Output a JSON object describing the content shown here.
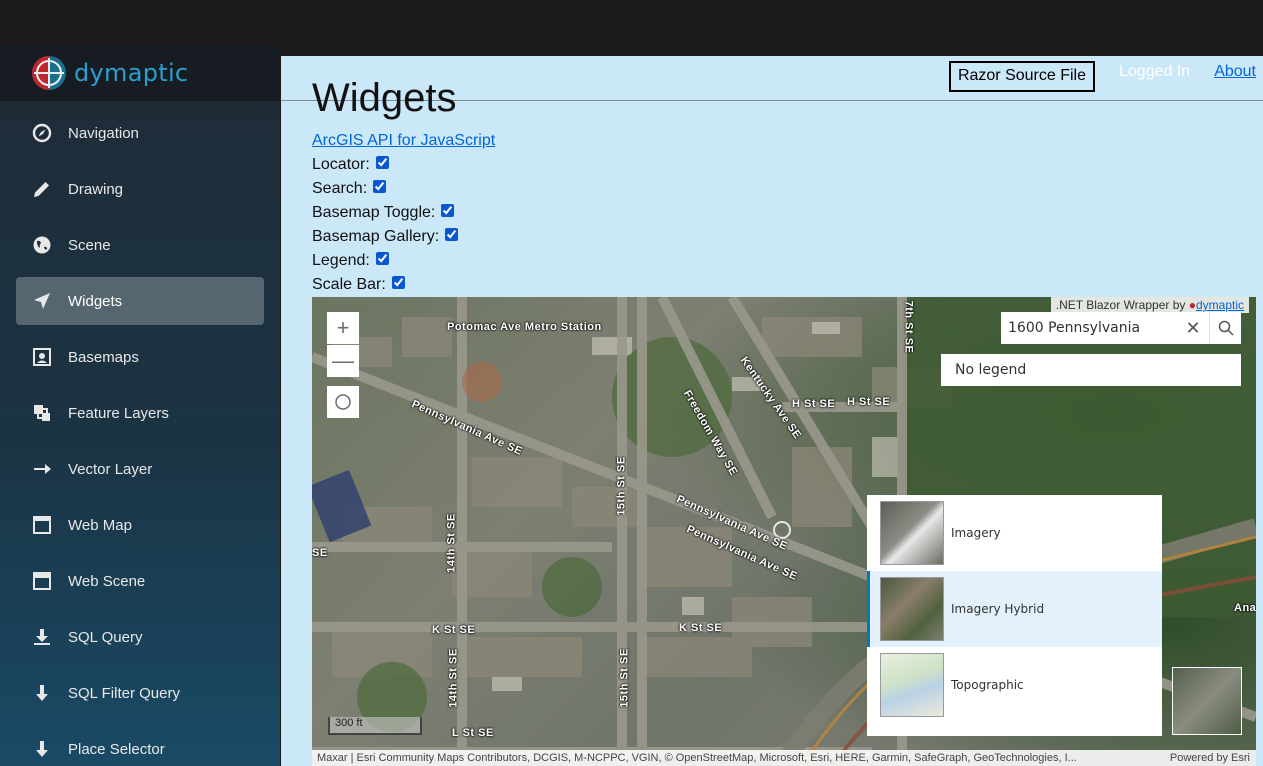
{
  "brand": {
    "name": "dymaptic"
  },
  "nav": [
    {
      "label": "Navigation",
      "icon": "compass-icon"
    },
    {
      "label": "Drawing",
      "icon": "pencil-icon"
    },
    {
      "label": "Scene",
      "icon": "globe-icon"
    },
    {
      "label": "Widgets",
      "icon": "location-arrow-icon",
      "active": true
    },
    {
      "label": "Basemaps",
      "icon": "map-image-icon"
    },
    {
      "label": "Feature Layers",
      "icon": "layers-icon"
    },
    {
      "label": "Vector Layer",
      "icon": "arrow-right-icon"
    },
    {
      "label": "Web Map",
      "icon": "browser-window-icon"
    },
    {
      "label": "Web Scene",
      "icon": "browser-window-icon"
    },
    {
      "label": "SQL Query",
      "icon": "download-icon"
    },
    {
      "label": "SQL Filter Query",
      "icon": "arrow-down-icon"
    },
    {
      "label": "Place Selector",
      "icon": "arrow-down-icon"
    }
  ],
  "header": {
    "razor_button": "Razor Source File",
    "logged_in": "Logged In",
    "about": "About"
  },
  "page": {
    "title": "Widgets",
    "api_link": "ArcGIS API for JavaScript",
    "options": [
      {
        "label": "Locator:",
        "checked": true
      },
      {
        "label": "Search:",
        "checked": true
      },
      {
        "label": "Basemap Toggle:",
        "checked": true
      },
      {
        "label": "Basemap Gallery:",
        "checked": true
      },
      {
        "label": "Legend:",
        "checked": true
      },
      {
        "label": "Scale Bar:",
        "checked": true
      }
    ]
  },
  "map": {
    "attribution_top": ".NET Blazor Wrapper by",
    "attribution_top_link": "dymaptic",
    "search_value": "1600 Pennsylvania",
    "legend_text": "No legend",
    "gallery": [
      {
        "label": "Imagery"
      },
      {
        "label": "Imagery Hybrid",
        "selected": true
      },
      {
        "label": "Topographic"
      }
    ],
    "scale": "300 ft",
    "attribution_bottom": "Maxar | Esri Community Maps Contributors, DCGIS, M-NCPPC, VGIN, © OpenStreetMap, Microsoft, Esri, HERE, Garmin, SafeGraph, GeoTechnologies, I...",
    "powered_by": "Powered by Esri",
    "road_labels": [
      "Potomac Ave Metro Station",
      "Pennsylvania Ave SE",
      "Freedom Way SE",
      "Kentucky Ave SE",
      "7th St SE",
      "H St SE",
      "H St SE",
      "15th St SE",
      "14th St SE",
      "Pennsylvania Ave SE",
      "Pennsylvania Ave SE",
      "K St SE",
      "K St SE",
      "14th St SE",
      "15th St SE",
      "L St SE",
      "SE",
      "Ana"
    ]
  }
}
